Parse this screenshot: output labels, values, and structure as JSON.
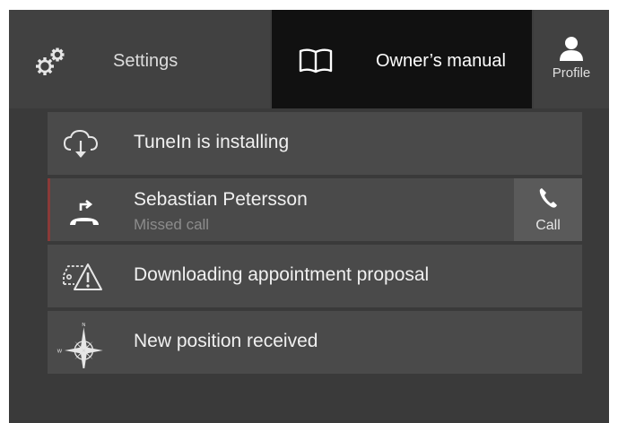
{
  "topbar": {
    "settings_label": "Settings",
    "settings_icon": "gears-icon",
    "manual_label": "Owner’s manual",
    "manual_icon": "book-icon",
    "profile_label": "Profile",
    "profile_icon": "person-icon"
  },
  "notifications": [
    {
      "icon": "cloud-download-icon",
      "title": "TuneIn is installing"
    },
    {
      "icon": "missed-call-icon",
      "title": "Sebastian Petersson",
      "subtitle": "Missed call",
      "action_label": "Call",
      "action_icon": "phone-icon"
    },
    {
      "icon": "car-warning-icon",
      "title": "Downloading appointment proposal"
    },
    {
      "icon": "compass-rose-icon",
      "title": "New position received"
    }
  ],
  "colors": {
    "background": "#3a3a3a",
    "card": "#4a4a4a",
    "active_tab": "#111111",
    "missed_accent": "#8a3a38"
  }
}
